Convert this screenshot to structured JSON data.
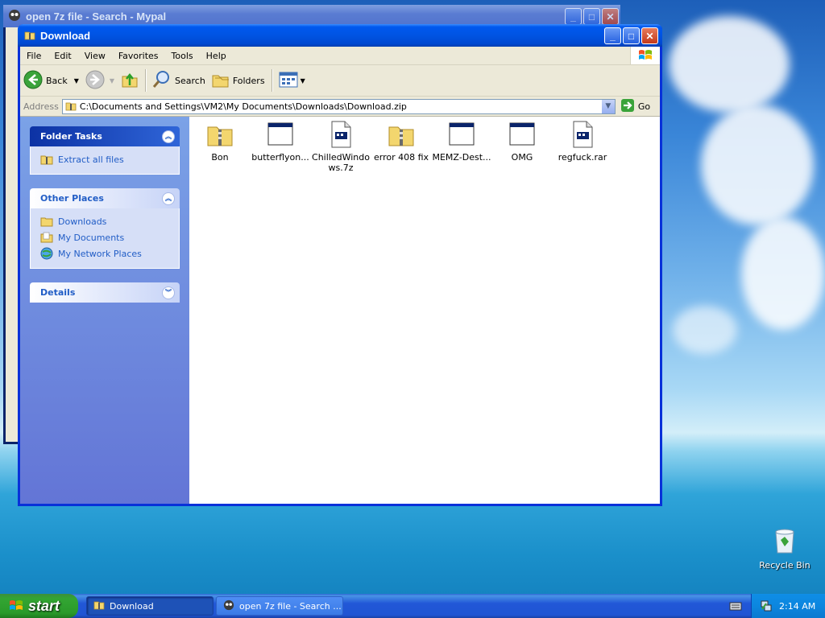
{
  "background_window": {
    "title": "open 7z file - Search - Mypal"
  },
  "window": {
    "title": "Download",
    "controls": {
      "minimize": "_",
      "maximize": "□",
      "close": "✕"
    }
  },
  "menu": [
    "File",
    "Edit",
    "View",
    "Favorites",
    "Tools",
    "Help"
  ],
  "toolbar": {
    "back_label": "Back",
    "search_label": "Search",
    "folders_label": "Folders"
  },
  "address": {
    "label": "Address",
    "value": "C:\\Documents and Settings\\VM2\\My Documents\\Downloads\\Download.zip",
    "go_label": "Go"
  },
  "taskpane": {
    "folder_tasks": {
      "title": "Folder Tasks",
      "items": [
        {
          "label": "Extract all files",
          "icon": "extract-icon"
        }
      ]
    },
    "other_places": {
      "title": "Other Places",
      "items": [
        {
          "label": "Downloads",
          "icon": "folder-icon"
        },
        {
          "label": "My Documents",
          "icon": "documents-folder-icon"
        },
        {
          "label": "My Network Places",
          "icon": "network-places-icon"
        }
      ]
    },
    "details": {
      "title": "Details"
    }
  },
  "files": [
    {
      "name": "Bon",
      "icon": "zip-folder-icon"
    },
    {
      "name": "butterflyon...",
      "icon": "application-icon"
    },
    {
      "name": "ChilledWindows.7z",
      "icon": "archive-file-icon"
    },
    {
      "name": "error 408 fix",
      "icon": "zip-folder-icon"
    },
    {
      "name": "MEMZ-Dest...",
      "icon": "application-icon"
    },
    {
      "name": "OMG",
      "icon": "application-icon"
    },
    {
      "name": "regfuck.rar",
      "icon": "archive-file-icon"
    }
  ],
  "desktop": {
    "recycle_bin_label": "Recycle Bin"
  },
  "taskbar": {
    "start_label": "start",
    "items": [
      {
        "label": "Download",
        "state": "active"
      },
      {
        "label": "open 7z file - Search ...",
        "state": "inactive"
      }
    ],
    "clock": "2:14 AM"
  },
  "colors": {
    "xp_blue": "#0054e3",
    "taskpane_link": "#215dc6",
    "start_green": "#33a533"
  }
}
